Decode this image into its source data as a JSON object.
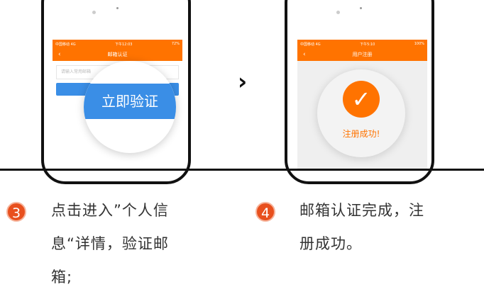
{
  "left_phone": {
    "status": {
      "carrier": "中国移动 4G",
      "time": "下午12:03",
      "battery": "72%"
    },
    "title": "邮箱认证",
    "back": "‹",
    "input_placeholder": "请输入常用邮箱",
    "button_label": "立即验证"
  },
  "arrow": "›",
  "right_phone": {
    "status": {
      "carrier": "中国移动 4G",
      "time": "下午5:10",
      "battery": "100%"
    },
    "title": "用户注册",
    "back": "‹",
    "check": "✓",
    "success": "注册成功!"
  },
  "steps": [
    {
      "number": "3",
      "lines": [
        "点击进入”个人信",
        "息“详情，验证邮",
        "箱;"
      ]
    },
    {
      "number": "4",
      "lines": [
        "邮箱认证完成，注",
        "册成功。"
      ]
    }
  ],
  "colors": {
    "orange": "#ff7300",
    "blue": "#3a8ee6",
    "step": "#e8501e"
  }
}
